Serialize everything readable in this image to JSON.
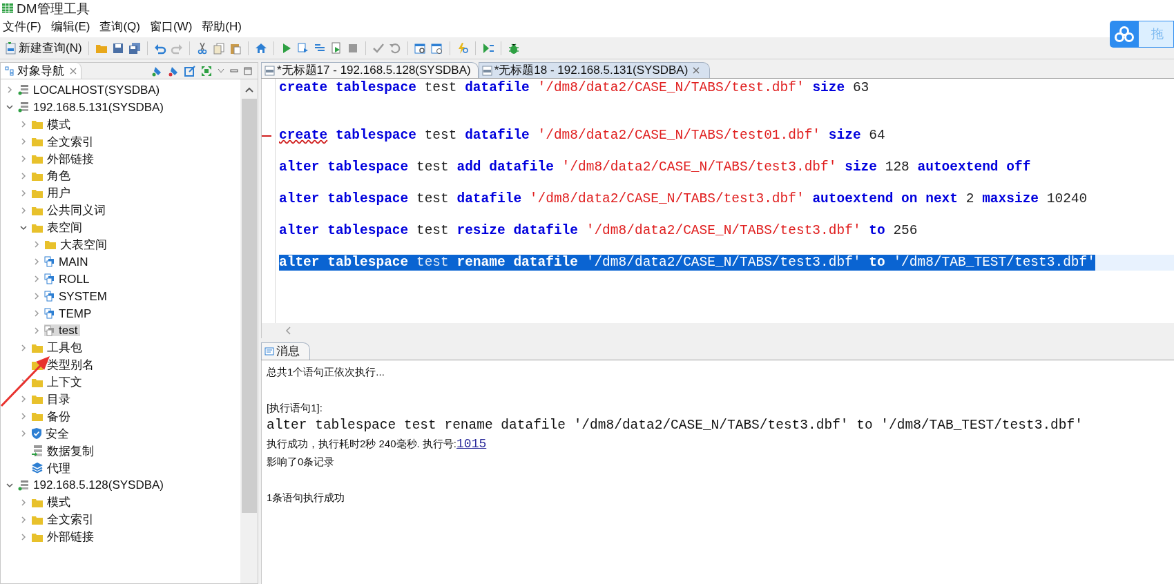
{
  "window": {
    "title": "DM管理工具"
  },
  "menu": [
    "文件(F)",
    "编辑(E)",
    "查询(Q)",
    "窗口(W)",
    "帮助(H)"
  ],
  "toolbar": {
    "new_query": "新建查询(N)"
  },
  "floating_widget": {
    "label": "拖"
  },
  "navigator": {
    "title": "对象导航",
    "tree": [
      {
        "label": "LOCALHOST(SYSDBA)",
        "kind": "connection",
        "expandable": true,
        "expanded": false,
        "selected": false
      },
      {
        "label": "192.168.5.131(SYSDBA)",
        "kind": "connection",
        "expandable": true,
        "expanded": true,
        "selected": false,
        "children": [
          {
            "label": "模式",
            "kind": "folder",
            "expandable": true,
            "expanded": false,
            "selected": false
          },
          {
            "label": "全文索引",
            "kind": "folder",
            "expandable": true,
            "expanded": false,
            "selected": false
          },
          {
            "label": "外部链接",
            "kind": "folder",
            "expandable": true,
            "expanded": false,
            "selected": false
          },
          {
            "label": "角色",
            "kind": "folder",
            "expandable": true,
            "expanded": false,
            "selected": false
          },
          {
            "label": "用户",
            "kind": "folder",
            "expandable": true,
            "expanded": false,
            "selected": false
          },
          {
            "label": "公共同义词",
            "kind": "folder",
            "expandable": true,
            "expanded": false,
            "selected": false
          },
          {
            "label": "表空间",
            "kind": "folder",
            "expandable": true,
            "expanded": true,
            "selected": false,
            "children": [
              {
                "label": "大表空间",
                "kind": "folder",
                "expandable": true,
                "expanded": false,
                "selected": false
              },
              {
                "label": "MAIN",
                "kind": "tablespace",
                "expandable": true,
                "expanded": false,
                "selected": false,
                "offline": false
              },
              {
                "label": "ROLL",
                "kind": "tablespace",
                "expandable": true,
                "expanded": false,
                "selected": false,
                "offline": false
              },
              {
                "label": "SYSTEM",
                "kind": "tablespace",
                "expandable": true,
                "expanded": false,
                "selected": false,
                "offline": false
              },
              {
                "label": "TEMP",
                "kind": "tablespace",
                "expandable": true,
                "expanded": false,
                "selected": false,
                "offline": false
              },
              {
                "label": "test",
                "kind": "tablespace",
                "expandable": true,
                "expanded": false,
                "selected": true,
                "offline": true
              }
            ]
          },
          {
            "label": "工具包",
            "kind": "folder",
            "expandable": true,
            "expanded": false,
            "selected": false
          },
          {
            "label": "类型别名",
            "kind": "folder",
            "expandable": false,
            "selected": false
          },
          {
            "label": "上下文",
            "kind": "folder",
            "expandable": true,
            "expanded": false,
            "selected": false
          },
          {
            "label": "目录",
            "kind": "folder",
            "expandable": true,
            "expanded": false,
            "selected": false
          },
          {
            "label": "备份",
            "kind": "folder",
            "expandable": true,
            "expanded": false,
            "selected": false
          },
          {
            "label": "安全",
            "kind": "security",
            "expandable": true,
            "expanded": false,
            "selected": false
          },
          {
            "label": "数据复制",
            "kind": "replication",
            "expandable": false,
            "selected": false
          },
          {
            "label": "代理",
            "kind": "agent",
            "expandable": false,
            "selected": false
          }
        ]
      },
      {
        "label": "192.168.5.128(SYSDBA)",
        "kind": "connection",
        "expandable": true,
        "expanded": true,
        "selected": false,
        "children": [
          {
            "label": "模式",
            "kind": "folder",
            "expandable": true,
            "expanded": false,
            "selected": false
          },
          {
            "label": "全文索引",
            "kind": "folder",
            "expandable": true,
            "expanded": false,
            "selected": false
          },
          {
            "label": "外部链接",
            "kind": "folder",
            "expandable": true,
            "expanded": false,
            "selected": false
          }
        ]
      }
    ]
  },
  "editor": {
    "tabs": [
      {
        "label": "*无标题17 - 192.168.5.128(SYSDBA)",
        "selected": false
      },
      {
        "label": "*无标题18 - 192.168.5.131(SYSDBA)",
        "selected": true
      }
    ],
    "lines": [
      {
        "kind": "code",
        "selected": false,
        "error": false,
        "tokens": [
          {
            "kind": "keyword",
            "text": "create "
          },
          {
            "kind": "keyword",
            "text": "tablespace "
          },
          {
            "kind": "plain",
            "text": "test "
          },
          {
            "kind": "keyword",
            "text": "datafile "
          },
          {
            "kind": "string",
            "text": "'/dm8/data2/CASE_N/TABS/test.dbf' "
          },
          {
            "kind": "keyword",
            "text": "size "
          },
          {
            "kind": "plain",
            "text": "63"
          }
        ]
      },
      {
        "kind": "blank"
      },
      {
        "kind": "blank"
      },
      {
        "kind": "code",
        "selected": false,
        "error": true,
        "tokens": [
          {
            "kind": "keyword",
            "text": "create"
          },
          {
            "kind": "keyword",
            "text": " tablespace "
          },
          {
            "kind": "plain",
            "text": "test "
          },
          {
            "kind": "keyword",
            "text": "datafile "
          },
          {
            "kind": "string",
            "text": "'/dm8/data2/CASE_N/TABS/test01.dbf' "
          },
          {
            "kind": "keyword",
            "text": "size "
          },
          {
            "kind": "plain",
            "text": "64"
          }
        ]
      },
      {
        "kind": "blank"
      },
      {
        "kind": "code",
        "selected": false,
        "error": false,
        "tokens": [
          {
            "kind": "keyword",
            "text": "alter "
          },
          {
            "kind": "keyword",
            "text": "tablespace "
          },
          {
            "kind": "plain",
            "text": "test "
          },
          {
            "kind": "keyword",
            "text": "add "
          },
          {
            "kind": "keyword",
            "text": "datafile "
          },
          {
            "kind": "string",
            "text": "'/dm8/data2/CASE_N/TABS/test3.dbf' "
          },
          {
            "kind": "keyword",
            "text": "size "
          },
          {
            "kind": "plain",
            "text": "128 "
          },
          {
            "kind": "keyword",
            "text": "autoextend "
          },
          {
            "kind": "keyword",
            "text": "off"
          }
        ]
      },
      {
        "kind": "blank"
      },
      {
        "kind": "code",
        "selected": false,
        "error": false,
        "tokens": [
          {
            "kind": "keyword",
            "text": "alter "
          },
          {
            "kind": "keyword",
            "text": "tablespace "
          },
          {
            "kind": "plain",
            "text": "test "
          },
          {
            "kind": "keyword",
            "text": "datafile "
          },
          {
            "kind": "string",
            "text": "'/dm8/data2/CASE_N/TABS/test3.dbf' "
          },
          {
            "kind": "keyword",
            "text": "autoextend "
          },
          {
            "kind": "keyword",
            "text": "on "
          },
          {
            "kind": "keyword",
            "text": "next "
          },
          {
            "kind": "plain",
            "text": "2 "
          },
          {
            "kind": "keyword",
            "text": "maxsize "
          },
          {
            "kind": "plain",
            "text": "10240"
          }
        ]
      },
      {
        "kind": "blank"
      },
      {
        "kind": "code",
        "selected": false,
        "error": false,
        "tokens": [
          {
            "kind": "keyword",
            "text": "alter "
          },
          {
            "kind": "keyword",
            "text": "tablespace "
          },
          {
            "kind": "plain",
            "text": "test "
          },
          {
            "kind": "keyword",
            "text": "resize "
          },
          {
            "kind": "keyword",
            "text": "datafile "
          },
          {
            "kind": "string",
            "text": "'/dm8/data2/CASE_N/TABS/test3.dbf' "
          },
          {
            "kind": "keyword",
            "text": "to "
          },
          {
            "kind": "plain",
            "text": "256"
          }
        ]
      },
      {
        "kind": "blank"
      },
      {
        "kind": "code",
        "selected": true,
        "error": false,
        "tokens": [
          {
            "kind": "keyword",
            "text": "alter "
          },
          {
            "kind": "keyword",
            "text": "tablespace "
          },
          {
            "kind": "plain",
            "text": "test "
          },
          {
            "kind": "keyword",
            "text": "rename "
          },
          {
            "kind": "keyword",
            "text": "datafile "
          },
          {
            "kind": "string",
            "text": "'/dm8/data2/CASE_N/TABS/test3.dbf' "
          },
          {
            "kind": "keyword",
            "text": "to "
          },
          {
            "kind": "string",
            "text": "'/dm8/TAB_TEST/test3.dbf'"
          }
        ]
      }
    ]
  },
  "messages": {
    "tab": "消息",
    "lines": [
      {
        "kind": "text",
        "text": "总共1个语句正依次执行..."
      },
      {
        "kind": "blank"
      },
      {
        "kind": "text",
        "text": "[执行语句1]:"
      },
      {
        "kind": "code",
        "text": "alter tablespace test rename datafile '/dm8/data2/CASE_N/TABS/test3.dbf' to '/dm8/TAB_TEST/test3.dbf'"
      },
      {
        "kind": "result",
        "text": "执行成功，执行耗时2秒 240毫秒. 执行号:",
        "link": "1015"
      },
      {
        "kind": "text",
        "text": "影响了0条记录"
      },
      {
        "kind": "blank"
      },
      {
        "kind": "text",
        "text": "1条语句执行成功"
      }
    ]
  }
}
